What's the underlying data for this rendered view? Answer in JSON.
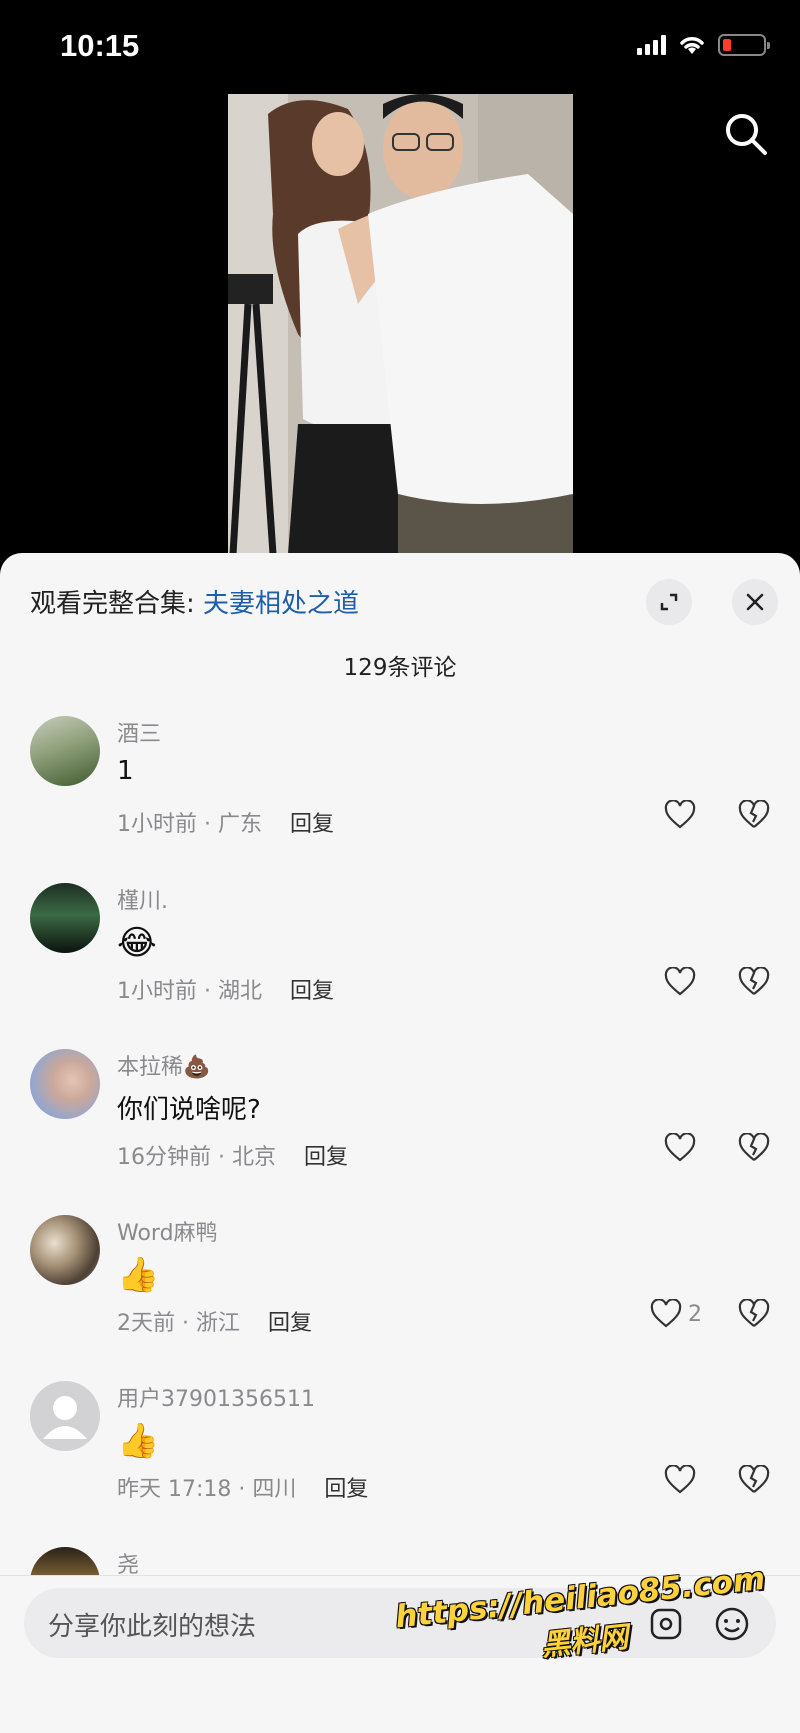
{
  "status_bar": {
    "time": "10:15"
  },
  "collection": {
    "prefix": "观看完整合集:",
    "name": "夫妻相处之道"
  },
  "comment_count": "129条评论",
  "comments": [
    {
      "username": "酒三",
      "text": "1",
      "time_location": "1小时前 · 广东",
      "reply_label": "回复",
      "likes": "",
      "avatar_icon": "avatar-photo"
    },
    {
      "username": "槿川.",
      "text": "😂",
      "time_location": "1小时前 · 湖北",
      "reply_label": "回复",
      "likes": "",
      "avatar_icon": "avatar-photo"
    },
    {
      "username": "本拉稀💩",
      "text": "你们说啥呢?",
      "time_location": "16分钟前 · 北京",
      "reply_label": "回复",
      "likes": "",
      "avatar_icon": "avatar-photo"
    },
    {
      "username": "Word麻鸭",
      "text": "👍",
      "time_location": "2天前 · 浙江",
      "reply_label": "回复",
      "likes": "2",
      "avatar_icon": "avatar-photo"
    },
    {
      "username": "用户37901356511",
      "text": "👍",
      "time_location": "昨天 17:18 · 四川",
      "reply_label": "回复",
      "likes": "",
      "avatar_icon": "default-avatar"
    },
    {
      "username": "尧",
      "text": "",
      "time_location": "",
      "reply_label": "",
      "likes": "",
      "avatar_icon": "avatar-photo"
    }
  ],
  "input": {
    "placeholder": "分享你此刻的想法"
  },
  "watermark": {
    "url": "https://heiliao85.com",
    "text": "黑料网"
  }
}
